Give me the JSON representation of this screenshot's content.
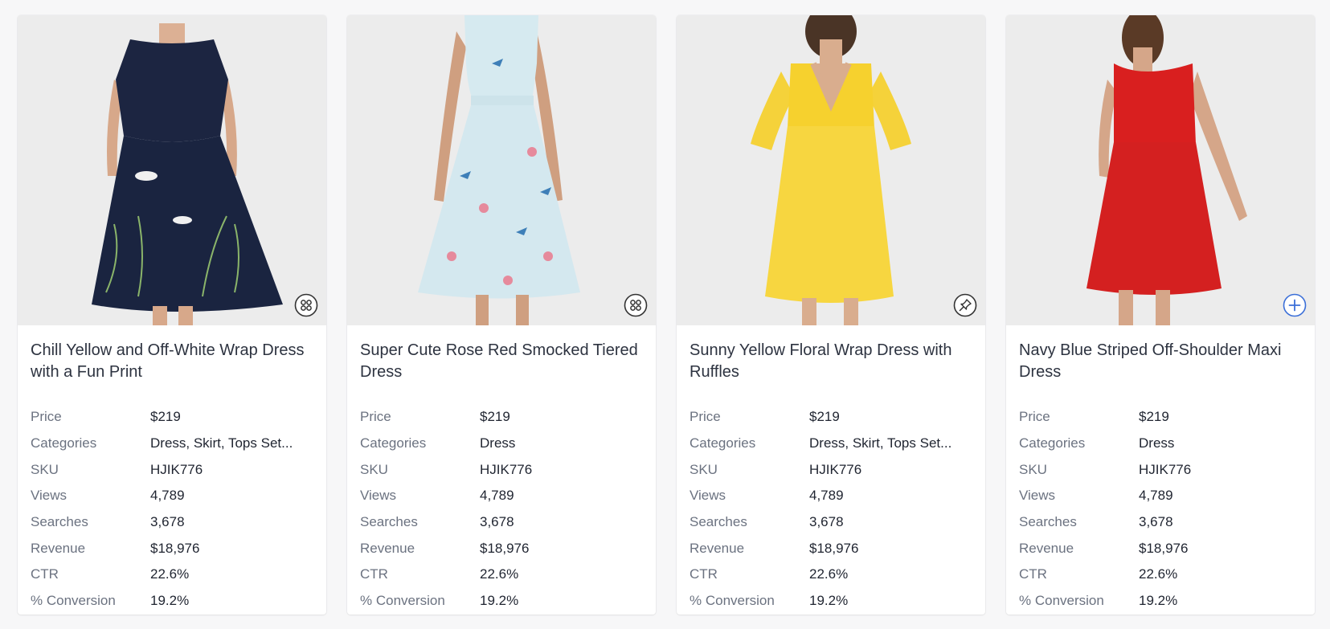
{
  "labels": {
    "price": "Price",
    "categories": "Categories",
    "sku": "SKU",
    "views": "Views",
    "searches": "Searches",
    "revenue": "Revenue",
    "ctr": "CTR",
    "conversion": "% Conversion"
  },
  "products": [
    {
      "title": "Chill Yellow and Off-White Wrap Dress with a Fun Print",
      "price": "$219",
      "categories": "Dress, Skirt, Tops Set...",
      "sku": "HJIK776",
      "views": "4,789",
      "searches": "3,678",
      "revenue": "$18,976",
      "ctr": "22.6%",
      "conversion": "19.2%",
      "action_icon": "grid-circle-icon"
    },
    {
      "title": "Super Cute Rose Red Smocked Tiered Dress",
      "price": "$219",
      "categories": "Dress",
      "sku": "HJIK776",
      "views": "4,789",
      "searches": "3,678",
      "revenue": "$18,976",
      "ctr": "22.6%",
      "conversion": "19.2%",
      "action_icon": "grid-circle-icon"
    },
    {
      "title": "Sunny Yellow Floral Wrap Dress with Ruffles",
      "price": "$219",
      "categories": "Dress, Skirt, Tops Set...",
      "sku": "HJIK776",
      "views": "4,789",
      "searches": "3,678",
      "revenue": "$18,976",
      "ctr": "22.6%",
      "conversion": "19.2%",
      "action_icon": "pin-icon"
    },
    {
      "title": "Navy Blue Striped Off-Shoulder Maxi Dress",
      "price": "$219",
      "categories": "Dress",
      "sku": "HJIK776",
      "views": "4,789",
      "searches": "3,678",
      "revenue": "$18,976",
      "ctr": "22.6%",
      "conversion": "19.2%",
      "action_icon": "plus-circle-icon"
    }
  ],
  "colors": {
    "page_bg": "#f7f7f8",
    "card_bg": "#ffffff",
    "image_bg": "#eeeeee",
    "accent_blue": "#3b6fd8",
    "icon_dark": "#333333"
  }
}
